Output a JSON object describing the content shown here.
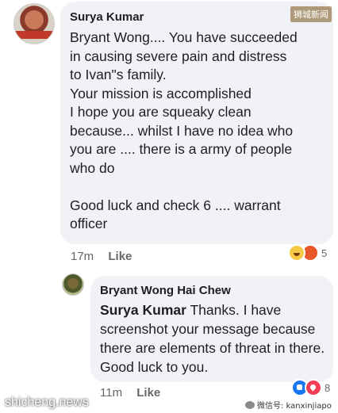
{
  "watermarks": {
    "top_right": "狮城新闻",
    "bottom_left": "shicheng.news",
    "bottom_right": "微信号: kanxinjiapo"
  },
  "comment": {
    "author": "Surya Kumar",
    "text": "Bryant Wong.... You have succeeded\nin causing severe pain and distress\nto Ivan\"s family.\nYour mission is accomplished\nI hope you are squeaky clean\nbecause... whilst I have no idea who\nyou are .... there is a army of people\nwho do\n\nGood luck and check 6 .... warrant\nofficer",
    "time": "17m",
    "like_label": "Like",
    "reaction_count": "5",
    "reaction_icons": [
      "haha-icon",
      "angry-icon"
    ]
  },
  "reply": {
    "author": "Bryant Wong Hai Chew",
    "mention": "Surya Kumar",
    "text": " Thanks. I have screenshot your message because there are elements of threat in there. Good luck to you.",
    "time": "11m",
    "like_label": "Like",
    "reaction_count": "8",
    "reaction_icons": [
      "like-icon",
      "love-icon"
    ]
  }
}
